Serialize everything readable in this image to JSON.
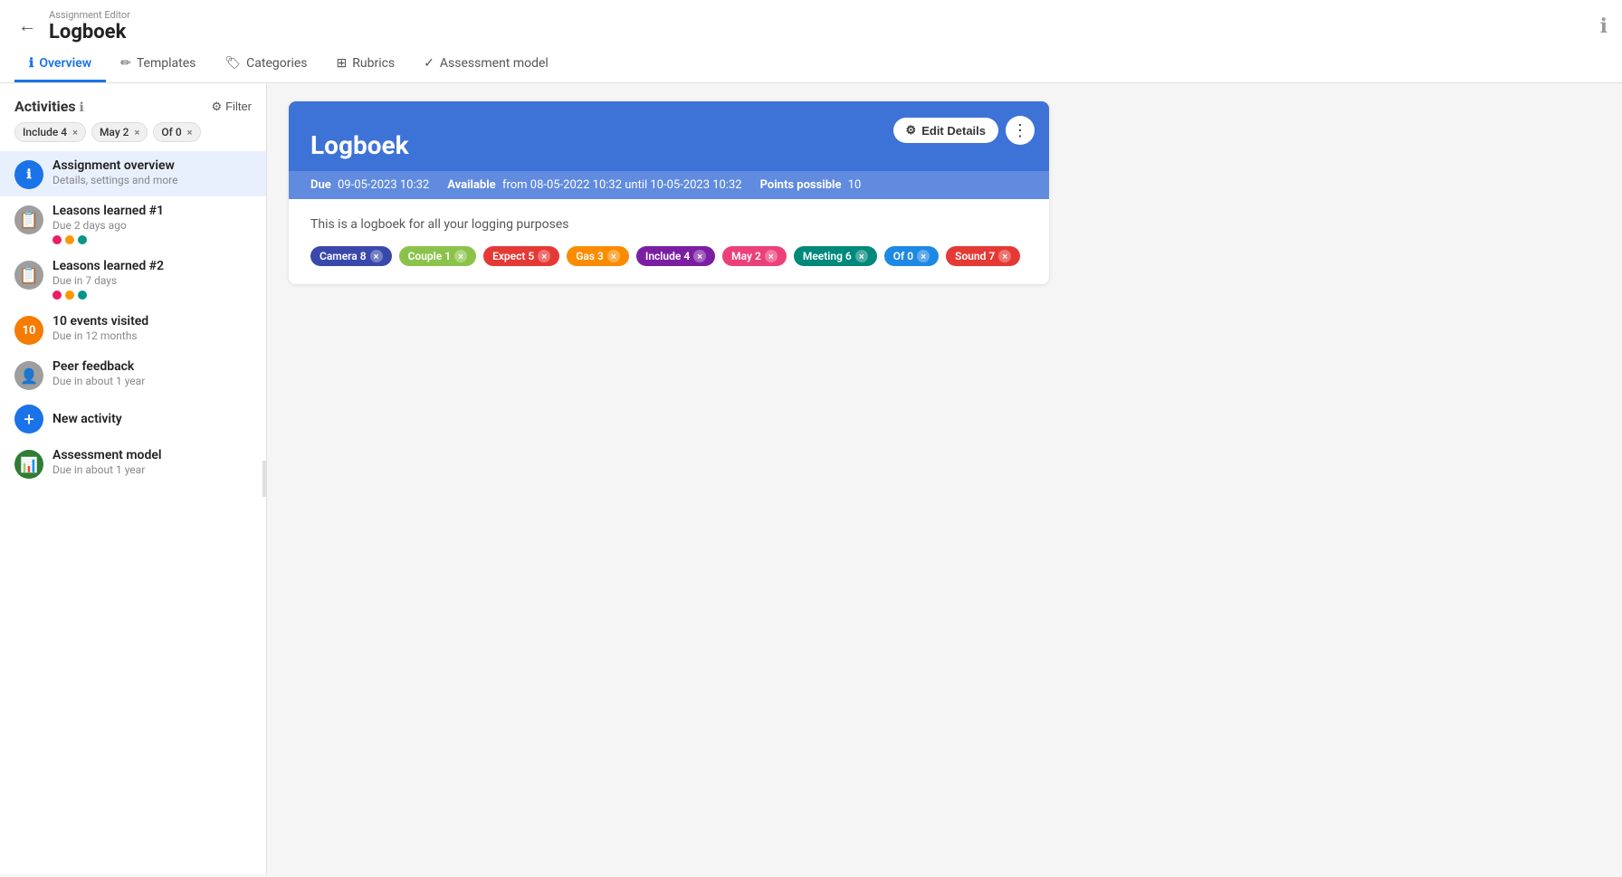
{
  "header": {
    "back_label": "←",
    "subtitle": "Assignment Editor",
    "title": "Logboek",
    "info_icon": "ℹ"
  },
  "nav": {
    "tabs": [
      {
        "id": "overview",
        "icon": "ℹ",
        "label": "Overview",
        "active": true
      },
      {
        "id": "templates",
        "icon": "✏",
        "label": "Templates",
        "active": false
      },
      {
        "id": "categories",
        "icon": "🏷",
        "label": "Categories",
        "active": false
      },
      {
        "id": "rubrics",
        "icon": "⊞",
        "label": "Rubrics",
        "active": false
      },
      {
        "id": "assessment",
        "icon": "✓",
        "label": "Assessment model",
        "active": false
      }
    ]
  },
  "sidebar": {
    "activities_title": "Activities",
    "filter_label": "Filter",
    "chips": [
      {
        "label": "Include 4",
        "id": "include"
      },
      {
        "label": "May 2",
        "id": "may"
      },
      {
        "label": "Of 0",
        "id": "of0"
      }
    ],
    "items": [
      {
        "id": "assignment-overview",
        "icon": "ℹ",
        "icon_type": "blue",
        "name": "Assignment overview",
        "sub": "Details, settings and more",
        "dots": [],
        "active": true
      },
      {
        "id": "leasons-1",
        "icon": "📋",
        "icon_type": "gray",
        "name": "Leasons learned #1",
        "sub": "Due 2 days ago",
        "dots": [
          "pink",
          "orange",
          "teal"
        ],
        "active": false
      },
      {
        "id": "leasons-2",
        "icon": "📋",
        "icon_type": "gray",
        "name": "Leasons learned #2",
        "sub": "Due in 7 days",
        "dots": [
          "pink",
          "orange",
          "teal"
        ],
        "active": false
      },
      {
        "id": "events",
        "icon": "10",
        "icon_type": "orange",
        "name": "10 events visited",
        "sub": "Due in 12 months",
        "dots": [],
        "active": false
      },
      {
        "id": "peer-feedback",
        "icon": "👤",
        "icon_type": "gray",
        "name": "Peer feedback",
        "sub": "Due in about 1 year",
        "dots": [],
        "active": false
      },
      {
        "id": "assessment-model",
        "icon": "📊",
        "icon_type": "green",
        "name": "Assessment model",
        "sub": "Due in about 1 year",
        "dots": [],
        "active": false
      }
    ],
    "new_activity_label": "New activity"
  },
  "card": {
    "title": "Logboek",
    "edit_details_label": "Edit Details",
    "more_icon": "⋮",
    "meta": {
      "due_label": "Due",
      "due_value": "09-05-2023 10:32",
      "available_label": "Available",
      "available_value": "from 08-05-2022 10:32 until 10-05-2023 10:32",
      "points_label": "Points possible",
      "points_value": "10"
    },
    "description": "This is a logboek for all your logging purposes",
    "tags": [
      {
        "id": "camera",
        "label": "Camera 8",
        "class": "camera",
        "close": "×"
      },
      {
        "id": "couple",
        "label": "Couple 1",
        "class": "couple",
        "close": "×"
      },
      {
        "id": "expect",
        "label": "Expect 5",
        "class": "expect",
        "close": "×"
      },
      {
        "id": "gas",
        "label": "Gas 3",
        "class": "gas",
        "close": "×"
      },
      {
        "id": "include",
        "label": "Include 4",
        "class": "include",
        "close": "×"
      },
      {
        "id": "may",
        "label": "May 2",
        "class": "may",
        "close": "×"
      },
      {
        "id": "meeting",
        "label": "Meeting 6",
        "class": "meeting",
        "close": "×"
      },
      {
        "id": "ofzero",
        "label": "Of 0",
        "class": "ofzero",
        "close": "×"
      },
      {
        "id": "sound",
        "label": "Sound 7",
        "class": "sound",
        "close": "×"
      }
    ]
  }
}
